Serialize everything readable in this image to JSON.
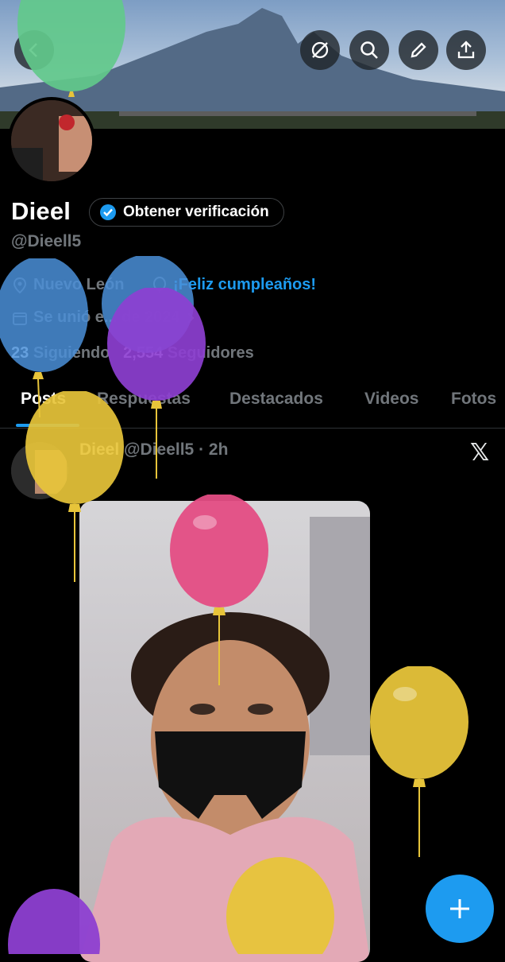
{
  "profile": {
    "name": "Dieel",
    "verify_label": "Obtener verificación",
    "handle": "@Dieell5",
    "location": "Nuevo León",
    "birthday": "¡Feliz cumpleaños!",
    "joined": "Se unió e... de 2024",
    "following_count": "23",
    "following_label": "Siguiendo",
    "followers_count": "2,554",
    "followers_label": "Seguidores"
  },
  "tabs": [
    "Posts",
    "Respuestas",
    "Destacados",
    "Videos",
    "Fotos"
  ],
  "post": {
    "author": "Dieel",
    "handle_time": "@Dieell5 · 2h"
  },
  "icons": {
    "back": "back-arrow-icon",
    "grok": "slash-circle-icon",
    "search": "search-icon",
    "edit": "pencil-icon",
    "share": "share-icon",
    "fab": "plus-icon",
    "x": "x-logo-icon"
  },
  "colors": {
    "accent": "#1d9bf0",
    "balloon_green": "#62c98b",
    "balloon_blue": "#4a8fd8",
    "balloon_purple": "#8d3fd1",
    "balloon_yellow": "#e7c43a",
    "balloon_pink": "#e44d84"
  }
}
